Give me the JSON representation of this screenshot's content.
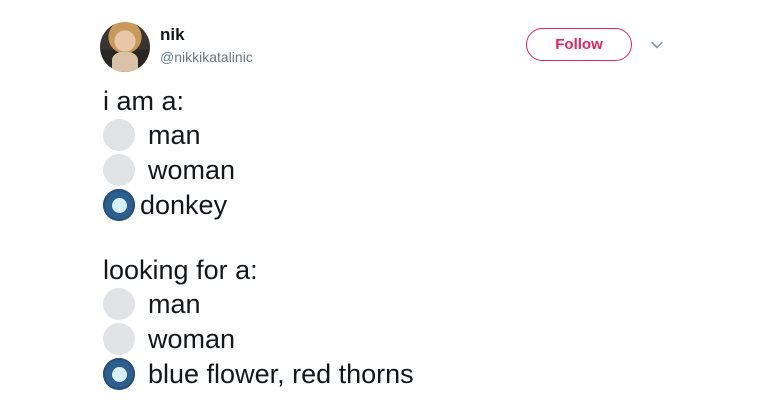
{
  "tweet": {
    "author": {
      "display_name": "nik",
      "handle": "@nikkikatalinic"
    },
    "follow_label": "Follow",
    "menu_icon": "chevron-down-icon",
    "accent_color": "#e0245e",
    "sections": [
      {
        "heading": "i am a:",
        "options": [
          {
            "label": "man",
            "selected": false
          },
          {
            "label": "woman",
            "selected": false
          },
          {
            "label": "donkey",
            "selected": true
          }
        ]
      },
      {
        "heading": "looking for a:",
        "options": [
          {
            "label": "man",
            "selected": false
          },
          {
            "label": "woman",
            "selected": false
          },
          {
            "label": "blue flower, red thorns",
            "selected": true
          }
        ]
      }
    ],
    "radio_colors": {
      "unselected": "#e1e3e6",
      "selected": "#2c5f8e",
      "selected_dot": "#d8f0fa"
    }
  }
}
